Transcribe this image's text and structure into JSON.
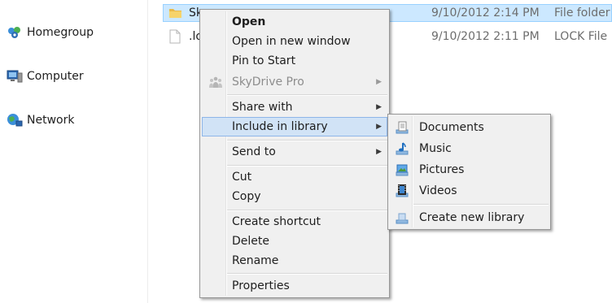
{
  "nav": {
    "items": [
      {
        "label": "Homegroup",
        "icon": "homegroup-icon"
      },
      {
        "label": "Computer",
        "icon": "computer-icon"
      },
      {
        "label": "Network",
        "icon": "network-icon"
      }
    ]
  },
  "files": [
    {
      "name": "Sk",
      "date": "9/10/2012 2:14 PM",
      "type": "File folder",
      "icon": "folder-icon"
    },
    {
      "name": ".lo",
      "date": "9/10/2012 2:11 PM",
      "type": "LOCK File",
      "icon": "file-icon"
    }
  ],
  "context_menu": {
    "items": [
      {
        "label": "Open"
      },
      {
        "label": "Open in new window"
      },
      {
        "label": "Pin to Start"
      },
      {
        "label": "SkyDrive Pro",
        "icon": "skydrive-pro-icon"
      },
      {
        "label": "Share with"
      },
      {
        "label": "Include in library"
      },
      {
        "label": "Send to"
      },
      {
        "label": "Cut"
      },
      {
        "label": "Copy"
      },
      {
        "label": "Create shortcut"
      },
      {
        "label": "Delete"
      },
      {
        "label": "Rename"
      },
      {
        "label": "Properties"
      }
    ]
  },
  "library_submenu": {
    "items": [
      {
        "label": "Documents",
        "icon": "documents-library-icon"
      },
      {
        "label": "Music",
        "icon": "music-library-icon"
      },
      {
        "label": "Pictures",
        "icon": "pictures-library-icon"
      },
      {
        "label": "Videos",
        "icon": "videos-library-icon"
      },
      {
        "label": "Create new library",
        "icon": "new-library-icon"
      }
    ]
  },
  "colors": {
    "selection": "#cce8ff",
    "menu_bg": "#f0f0f0",
    "menu_highlight": "#d1e3f6"
  }
}
